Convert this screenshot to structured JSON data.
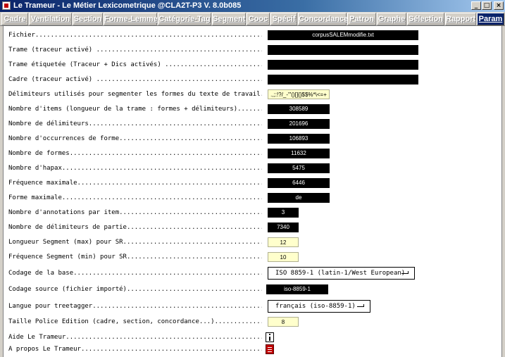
{
  "window": {
    "title": "Le Trameur - Le Métier Lexicometrique @CLA2T-P3 V. 8.0b085"
  },
  "tabs": [
    {
      "label": "Cadre"
    },
    {
      "label": "Ventilation"
    },
    {
      "label": "Section"
    },
    {
      "label": "Forme-Lemme"
    },
    {
      "label": "Catégorie-Tag"
    },
    {
      "label": "Segment"
    },
    {
      "label": "Cooc"
    },
    {
      "label": "Spécif"
    },
    {
      "label": "Concordance"
    },
    {
      "label": "Patron"
    },
    {
      "label": "Graphe"
    },
    {
      "label": "Sélection"
    },
    {
      "label": "Rapport"
    },
    {
      "label": "Param"
    }
  ],
  "active_tab": "Param",
  "params": {
    "fichier": {
      "label": "Fichier............................................................",
      "value": "corpusSALEMmodifie.txt"
    },
    "trame": {
      "label": "Trame (traceur activé) ..............................................",
      "value": ""
    },
    "trame_etiquetee": {
      "label": "Trame étiquetée (Traceur + Dics activés) .............................",
      "value": ""
    },
    "cadre": {
      "label": "Cadre (traceur activé) ..............................................",
      "value": ""
    },
    "delimiteurs": {
      "label": "Délimiteurs utilisés pour segmenter les formes du texte de travail......",
      "value": ".,;:!?/_-'\"()[]{}$$%*\\<=+"
    },
    "nb_items": {
      "label": "Nombre d'items (longueur de la trame : formes + délimiteurs).............",
      "value": "308589"
    },
    "nb_delimiteurs": {
      "label": "Nombre de délimiteurs.................................................",
      "value": "201696"
    },
    "nb_occurrences": {
      "label": "Nombre d'occurrences de forme.........................................",
      "value": "106893"
    },
    "nb_formes": {
      "label": "Nombre de formes......................................................",
      "value": "11632"
    },
    "nb_hapax": {
      "label": "Nombre d'hapax........................................................",
      "value": "5475"
    },
    "freq_max": {
      "label": "Fréquence maximale....................................................",
      "value": "6446"
    },
    "forme_max": {
      "label": "Forme maximale........................................................",
      "value": "de"
    },
    "nb_annotations": {
      "label": "Nombre d'annotations par item.........................................",
      "value": "3"
    },
    "nb_delim_partie": {
      "label": "Nombre de délimiteurs de partie.......................................",
      "value": "7340"
    },
    "long_segment_max": {
      "label": "Longueur Segment (max) pour SR.........................................",
      "value": "12"
    },
    "freq_segment_min": {
      "label": "Fréquence Segment (min) pour SR........................................",
      "value": "10"
    },
    "codage_base": {
      "label": "Codage de la base.....................................................",
      "value": "ISO 8859-1 (latin-1/West European)"
    },
    "codage_source": {
      "label": "Codage source (fichier importé).......................................",
      "value": "iso-8859-1"
    },
    "langue": {
      "label": "Langue pour treetagger................................................",
      "value": "français (iso-8859-1)"
    },
    "taille_police": {
      "label": "Taille Police Edition (cadre, section, concordance...).................",
      "value": "8"
    },
    "aide": {
      "label": "Aide Le Trameur......................................................."
    },
    "apropos": {
      "label": "A propos Le Trameur..................................................."
    }
  },
  "colors": {
    "titlebar": "#0a246a",
    "field_dark": "#000000",
    "field_light": "#ffffcc",
    "about_icon": "#c00000"
  }
}
